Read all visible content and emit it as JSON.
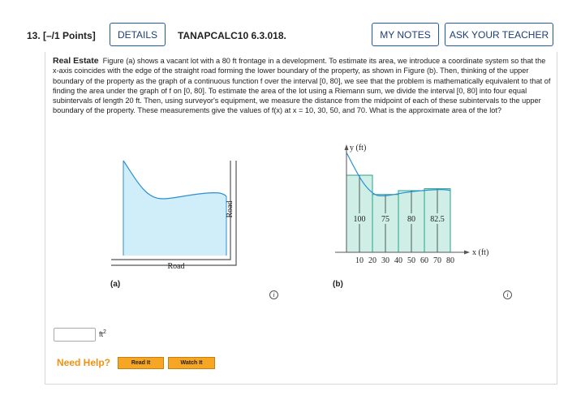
{
  "header": {
    "question_number": "13. [–/1 Points]",
    "details_label": "DETAILS",
    "question_code": "TANAPCALC10 6.3.018.",
    "my_notes_label": "MY NOTES",
    "ask_teacher_label": "ASK YOUR TEACHER"
  },
  "problem": {
    "title": "Real Estate",
    "text": "Figure (a) shows a vacant lot with a 80 ft frontage in a development. To estimate its area, we introduce a coordinate system so that the x-axis coincides with the edge of the straight road forming the lower boundary of the property, as shown in Figure (b). Then, thinking of the upper boundary of the property as the graph of a continuous function f over the interval [0, 80], we see that the problem is mathematically equivalent to that of finding the area under the graph of f on [0, 80]. To estimate the area of the lot using a Riemann sum, we divide the interval [0, 80] into four equal subintervals of length 20 ft. Then, using surveyor's equipment, we measure the distance from the midpoint of each of these subintervals to the upper boundary of the property. These measurements give the values of f(x) at x = 10, 30, 50, and 70. What is the approximate area of the lot?"
  },
  "figure_a": {
    "caption": "(a)",
    "road_bottom_label": "Road",
    "road_side_label": "Road",
    "fill_color": "#cfeefa"
  },
  "figure_b": {
    "caption": "(b)",
    "y_axis_label": "y (ft)",
    "x_axis_label": "x (ft)",
    "x_ticks": [
      "10",
      "20",
      "30",
      "40",
      "50",
      "60",
      "70",
      "80"
    ],
    "bar_values": [
      "100",
      "75",
      "80",
      "82.5"
    ],
    "bar_fill": "#cfeee6"
  },
  "answer": {
    "value": "",
    "unit": "ft",
    "unit_power": "2"
  },
  "help": {
    "need_help": "Need Help?",
    "read_it": "Read It",
    "watch_it": "Watch It"
  },
  "colors": {
    "brand_blue": "#1c5aa6",
    "help_orange": "#f29111",
    "button_orange": "#f6a623"
  }
}
